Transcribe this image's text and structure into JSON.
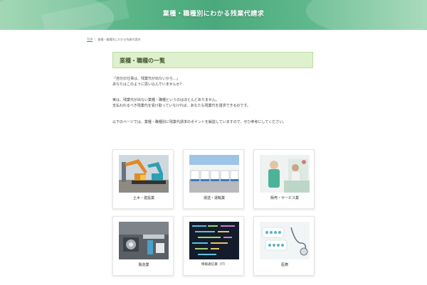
{
  "hero": {
    "title": "業種・職種別にわかる残業代請求"
  },
  "breadcrumb": {
    "top": "TOP",
    "separator": "/",
    "current": "業種・職種別にわかる残業代請求"
  },
  "section": {
    "heading": "業種・職種の一覧"
  },
  "intro": {
    "p1_line1": "「自分の仕事は、残業代が出ないから…」",
    "p1_line2": "あなたはこのように思い込んでいませんか？",
    "p2_line1": "実は、残業代が出ない業種・職種というのはほとんどありません。",
    "p2_line2": "支払われるべき残業代を受け取っていなければ、あなたも残業代を請求できるのです。",
    "p3_line1": "以下のページでは、業種・職種別に残業代請求のポイントを解説していますので、ぜひ参考にしてください。"
  },
  "cards": [
    {
      "label": "土木・建設業",
      "icon": "excavator-photo"
    },
    {
      "label": "運送・運輸業",
      "icon": "trucks-photo"
    },
    {
      "label": "販売・サービス業",
      "icon": "retail-photo"
    },
    {
      "label": "製造業",
      "icon": "factory-photo"
    },
    {
      "label": "情報通信業（IT）",
      "icon": "code-screen-photo"
    },
    {
      "label": "医療",
      "icon": "medical-photo"
    }
  ]
}
